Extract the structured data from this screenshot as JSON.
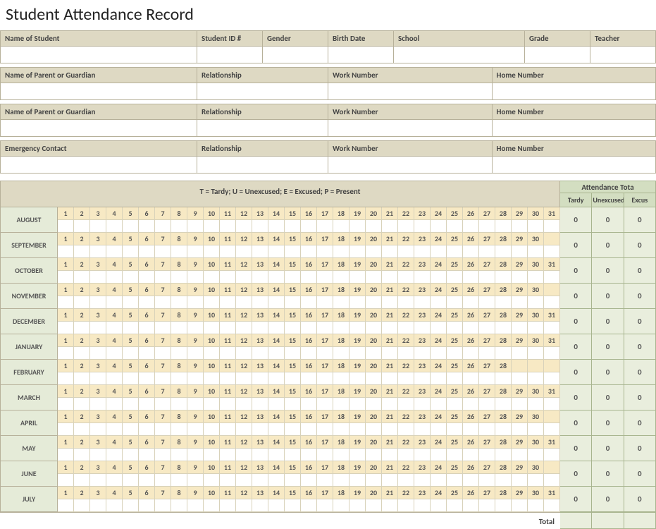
{
  "title": "Student Attendance Record",
  "header_rows": [
    {
      "cells": [
        {
          "label": "Name of Student",
          "span": 6
        },
        {
          "label": "Student ID #",
          "span": 2
        },
        {
          "label": "Gender",
          "span": 2
        },
        {
          "label": "Birth Date",
          "span": 2
        },
        {
          "label": "School",
          "span": 4
        },
        {
          "label": "Grade",
          "span": 2
        },
        {
          "label": "Teacher",
          "span": 2
        }
      ],
      "values": [
        "",
        "",
        "",
        "",
        "",
        "",
        ""
      ]
    },
    {
      "cells": [
        {
          "label": "Name of Parent or Guardian",
          "span": 6
        },
        {
          "label": "Relationship",
          "span": 4
        },
        {
          "label": "Work Number",
          "span": 5
        },
        {
          "label": "Home Number",
          "span": 5
        }
      ],
      "values": [
        "",
        "",
        "",
        ""
      ]
    },
    {
      "cells": [
        {
          "label": "Name of Parent or Guardian",
          "span": 6
        },
        {
          "label": "Relationship",
          "span": 4
        },
        {
          "label": "Work Number",
          "span": 5
        },
        {
          "label": "Home Number",
          "span": 5
        }
      ],
      "values": [
        "",
        "",
        "",
        ""
      ]
    },
    {
      "cells": [
        {
          "label": "Emergency Contact",
          "span": 6
        },
        {
          "label": "Relationship",
          "span": 4
        },
        {
          "label": "Work Number",
          "span": 5
        },
        {
          "label": "Home Number",
          "span": 5
        }
      ],
      "values": [
        "",
        "",
        "",
        ""
      ]
    }
  ],
  "legend": "T = Tardy; U = Unexcused; E = Excused; P = Present",
  "attendance_totals_label": "Attendance Tota",
  "totals_columns": [
    "Tardy",
    "Unexcused",
    "Excus"
  ],
  "total_label": "Total",
  "months": [
    {
      "name": "AUGUST",
      "days": 31,
      "totals": [
        "0",
        "0",
        "0"
      ]
    },
    {
      "name": "SEPTEMBER",
      "days": 30,
      "totals": [
        "0",
        "0",
        "0"
      ]
    },
    {
      "name": "OCTOBER",
      "days": 31,
      "totals": [
        "0",
        "0",
        "0"
      ]
    },
    {
      "name": "NOVEMBER",
      "days": 30,
      "totals": [
        "0",
        "0",
        "0"
      ]
    },
    {
      "name": "DECEMBER",
      "days": 31,
      "totals": [
        "0",
        "0",
        "0"
      ]
    },
    {
      "name": "JANUARY",
      "days": 31,
      "totals": [
        "0",
        "0",
        "0"
      ]
    },
    {
      "name": "FEBRUARY",
      "days": 28,
      "totals": [
        "0",
        "0",
        "0"
      ]
    },
    {
      "name": "MARCH",
      "days": 31,
      "totals": [
        "0",
        "0",
        "0"
      ]
    },
    {
      "name": "APRIL",
      "days": 30,
      "totals": [
        "0",
        "0",
        "0"
      ]
    },
    {
      "name": "MAY",
      "days": 31,
      "totals": [
        "0",
        "0",
        "0"
      ]
    },
    {
      "name": "JUNE",
      "days": 30,
      "totals": [
        "0",
        "0",
        "0"
      ]
    },
    {
      "name": "JULY",
      "days": 31,
      "totals": [
        "0",
        "0",
        "0"
      ]
    }
  ],
  "grand_totals": [
    "",
    "",
    ""
  ]
}
